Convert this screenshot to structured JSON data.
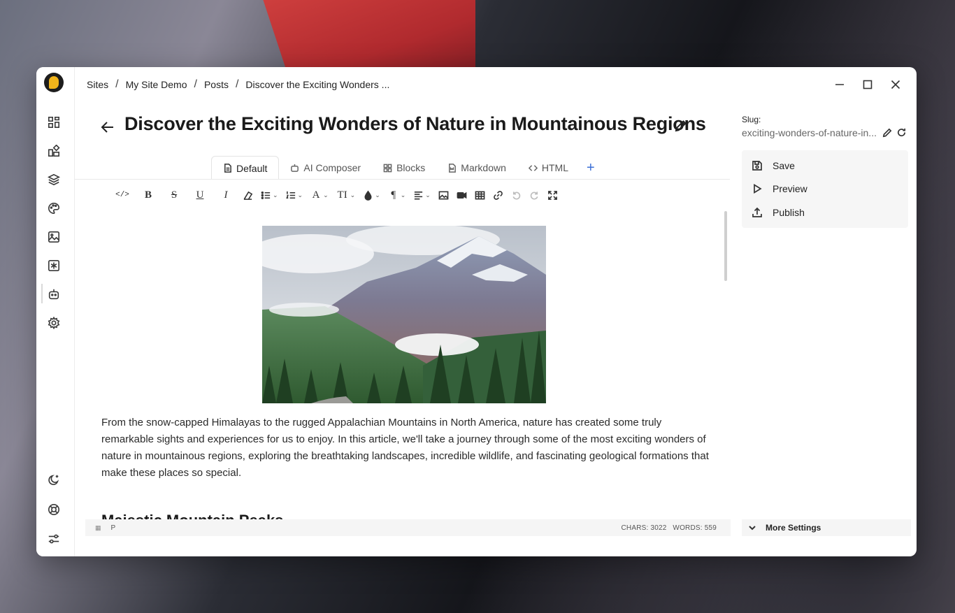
{
  "breadcrumb": [
    "Sites",
    "My Site Demo",
    "Posts",
    "Discover the Exciting Wonders ..."
  ],
  "breadcrumb_separator": "/",
  "post": {
    "title": "Discover the Exciting Wonders of Nature in Mountainous Regions",
    "intro": "From the snow-capped Himalayas to the rugged Appalachian Mountains in North America, nature has created some truly remarkable sights and experiences for us to enjoy. In this article, we'll take a journey through some of the most exciting wonders of nature in mountainous regions, exploring the breathtaking landscapes, incredible wildlife, and fascinating geological formations that make these places so special.",
    "next_heading": "Majestic Mountain Peaks"
  },
  "tabs": [
    {
      "label": "Default",
      "icon": "document-icon",
      "active": true
    },
    {
      "label": "AI Composer",
      "icon": "robot-icon",
      "active": false
    },
    {
      "label": "Blocks",
      "icon": "blocks-icon",
      "active": false
    },
    {
      "label": "Markdown",
      "icon": "markdown-file-icon",
      "active": false
    },
    {
      "label": "HTML",
      "icon": "code-icon",
      "active": false
    }
  ],
  "tab_add_label": "+",
  "toolbar": {
    "code": "</>",
    "bold": "B",
    "strike": "S",
    "underline": "U",
    "italic": "I",
    "font_color": "A",
    "text_size": "TI",
    "paragraph": "¶"
  },
  "status": {
    "element": "P",
    "counts": "CHARS: 3022   WORDS: 559"
  },
  "slug": {
    "label": "Slug:",
    "value": "exciting-wonders-of-nature-in..."
  },
  "actions": {
    "save": "Save",
    "preview": "Preview",
    "publish": "Publish"
  },
  "more_settings": "More Settings",
  "colors": {
    "accent": "#3b6fd6",
    "logo_yellow": "#f2b51b"
  }
}
